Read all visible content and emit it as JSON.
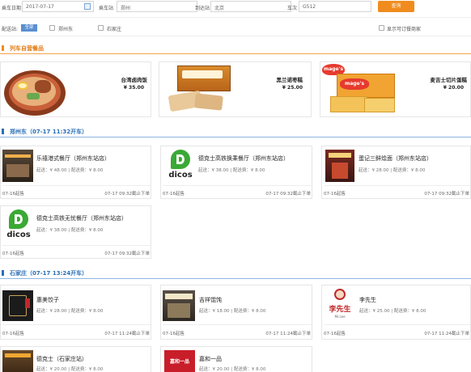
{
  "search": {
    "date_label": "乘车日期",
    "date_value": "2017-07-17",
    "from_label": "乘车站",
    "from_value": "郑州",
    "to_label": "到达站",
    "to_value": "北京",
    "train_label": "车次",
    "train_value": "G512",
    "button_label": "查询"
  },
  "filter": {
    "station_label": "配送站:",
    "all_label": "全部",
    "opt1_label": "郑州东",
    "opt2_label": "石家庄",
    "right_label": "显示可订餐商家"
  },
  "sections": {
    "s1_title": "列车自营餐品",
    "s2_title": "郑州东（07-17 11:32开车）",
    "s3_title": "石家庄（07-17 13:24开车）"
  },
  "products": [
    {
      "name": "台湾卤肉饭",
      "price": "¥ 35.00"
    },
    {
      "name": "黑兰诺枣糕",
      "price": "¥ 25.00"
    },
    {
      "name": "麦吉士切片蛋糕",
      "price": "¥ 20.00"
    }
  ],
  "zhengzhou": [
    {
      "name": "乐禧港式餐厅（郑州东站店）",
      "min": "起送：¥ 48.00",
      "fee": "配送费：¥ 8.00",
      "foot_l": "07-16起售",
      "foot_r": "07-17 09:32截止下单"
    },
    {
      "name": "德克士高铁换乘餐厅（郑州东站店）",
      "min": "起送：¥ 38.00",
      "fee": "配送费：¥ 8.00",
      "foot_l": "07-16起售",
      "foot_r": "07-17 09:32截止下单"
    },
    {
      "name": "蛋记三鲜烩面（郑州东站店）",
      "min": "起送：¥ 28.00",
      "fee": "配送费：¥ 8.00",
      "foot_l": "07-16起售",
      "foot_r": "07-17 09:32截止下单"
    },
    {
      "name": "德克士高铁无忧餐厅（郑州东站店）",
      "min": "起送：¥ 38.00",
      "fee": "配送费：¥ 8.00",
      "foot_l": "07-16起售",
      "foot_r": "07-17 09:32截止下单"
    }
  ],
  "shijiazhuang": [
    {
      "name": "惠美饺子",
      "min": "起送：¥ 28.00",
      "fee": "配送费：¥ 8.00",
      "foot_l": "07-16起售",
      "foot_r": "07-17 11:24截止下单"
    },
    {
      "name": "吉祥馄饨",
      "min": "起送：¥ 18.00",
      "fee": "配送费：¥ 8.00",
      "foot_l": "07-16起售",
      "foot_r": "07-17 11:24截止下单"
    },
    {
      "name": "李先生",
      "min": "起送：¥ 25.00",
      "fee": "配送费：¥ 8.00",
      "foot_l": "07-16起售",
      "foot_r": "07-17 11:24截止下单"
    },
    {
      "name": "德克士（石家庄站）",
      "min": "起送：¥ 20.00",
      "fee": "配送费：¥ 8.00"
    },
    {
      "name": "嘉和一品",
      "min": "起送：¥ 20.00",
      "fee": "配送费：¥ 8.00"
    }
  ],
  "logos": {
    "dicos": "dicos",
    "li_cn": "李先生",
    "li_en": "Mr.Lee",
    "mages": "mage's",
    "jiahe": "嘉和一品"
  },
  "colors": {
    "accent": "#f08c1e",
    "link_blue": "#2a6fb8",
    "section_line_orange": "#f5a34a",
    "section_line_blue": "#8fb6e0",
    "dicos_green": "#3aa935"
  }
}
